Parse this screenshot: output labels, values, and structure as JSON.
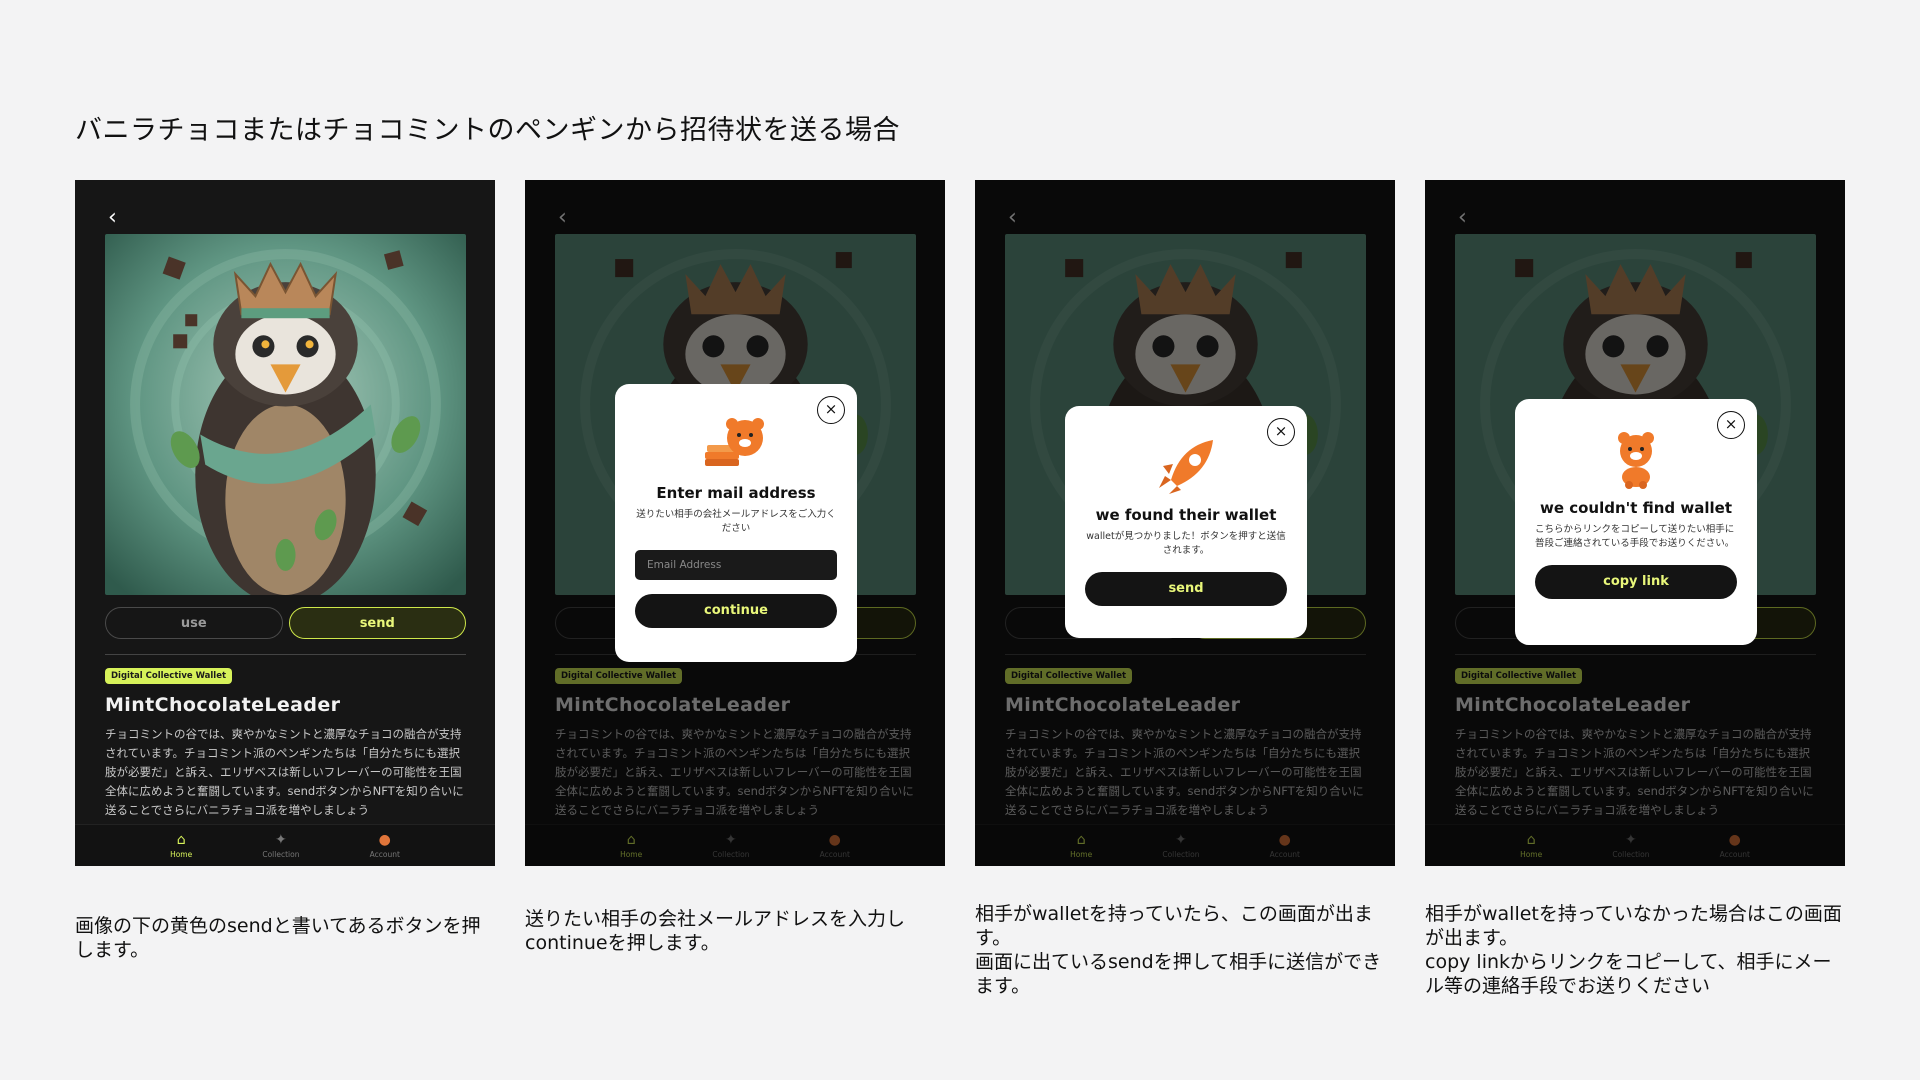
{
  "page": {
    "title": "バニラチョコまたはチョコミントのペンギンから招待状を送る場合"
  },
  "screen": {
    "back_icon": "chevron-left-icon",
    "use_label": "use",
    "send_label": "send",
    "badge": "Digital Collective Wallet",
    "nft_title": "MintChocolateLeader",
    "description": "チョコミントの谷では、爽やかなミントと濃厚なチョコの融合が支持されています。チョコミント派のペンギンたちは「自分たちにも選択肢が必要だ」と訴え、エリザベスは新しいフレーバーの可能性を王国全体に広めようと奮闘しています。sendボタンからNFTを知り合いに送ることでさらにバニラチョコ派を増やしましょう",
    "tabs": [
      {
        "label": "Home",
        "icon": "home-icon"
      },
      {
        "label": "Collection",
        "icon": "sparkle-icon"
      },
      {
        "label": "Account",
        "icon": "avatar-icon"
      }
    ]
  },
  "modals": {
    "mail": {
      "title": "Enter mail address",
      "subtitle": "送りたい相手の会社メールアドレスをご入力ください",
      "input_placeholder": "Email Address",
      "button": "continue",
      "icon": "bear-with-cards-icon"
    },
    "found": {
      "title": "we found their wallet",
      "subtitle": "walletが見つかりました！ボタンを押すと送信されます。",
      "button": "send",
      "icon": "rocket-icon"
    },
    "notfound": {
      "title": "we couldn't find wallet",
      "subtitle": "こちらからリンクをコピーして送りたい相手に 普段ご連絡されている手段でお送りください。",
      "button": "copy link",
      "icon": "bear-icon"
    }
  },
  "captions": [
    "画像の下の黄色のsendと書いてあるボタンを押します。",
    "送りたい相手の会社メールアドレスを入力しcontinueを押します。",
    "相手がwalletを持っていたら、この画面が出ます。\n画面に出ているsendを押して相手に送信ができます。",
    "相手がwalletを持っていなかった場合はこの画面が出ます。\ncopy linkからリンクをコピーして、相手にメール等の連絡手段でお送りください"
  ],
  "colors": {
    "accent": "#d7f25a",
    "background": "#f3f3f4",
    "phone_bg": "#161616",
    "orange": "#f07a2a"
  }
}
